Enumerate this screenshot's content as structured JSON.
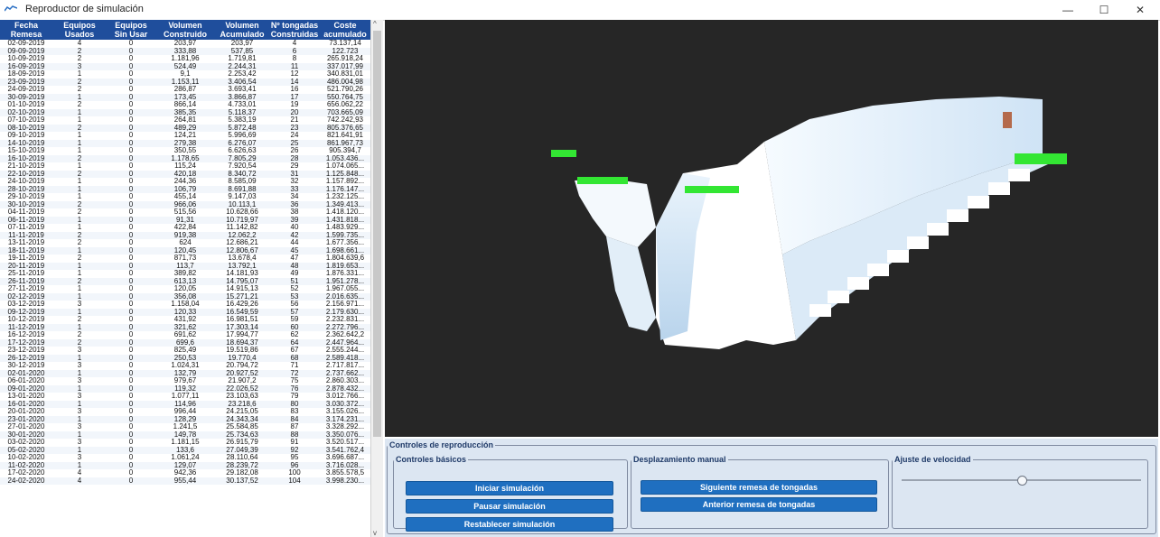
{
  "window": {
    "title": "Reproductor de simulación",
    "controls": {
      "minimize": "—",
      "maximize": "☐",
      "close": "✕"
    }
  },
  "table": {
    "headers": [
      [
        "Fecha",
        "Remesa"
      ],
      [
        "Equipos",
        "Usados"
      ],
      [
        "Equipos",
        "Sin Usar"
      ],
      [
        "Volumen",
        "Construido"
      ],
      [
        "Volumen",
        "Acumulado"
      ],
      [
        "Nº tongadas",
        "Construidas"
      ],
      [
        "Coste",
        "acumulado"
      ]
    ],
    "rows": [
      [
        "02-09-2019",
        "4",
        "0",
        "203,97",
        "203,97",
        "4",
        "73.137,14"
      ],
      [
        "09-09-2019",
        "2",
        "0",
        "333,88",
        "537,85",
        "6",
        "122.723"
      ],
      [
        "10-09-2019",
        "2",
        "0",
        "1.181,96",
        "1.719,81",
        "8",
        "265.918,24"
      ],
      [
        "16-09-2019",
        "3",
        "0",
        "524,49",
        "2.244,31",
        "11",
        "337.017,99"
      ],
      [
        "18-09-2019",
        "1",
        "0",
        "9,1",
        "2.253,42",
        "12",
        "340.831,01"
      ],
      [
        "23-09-2019",
        "2",
        "0",
        "1.153,11",
        "3.406,54",
        "14",
        "486.004,98"
      ],
      [
        "24-09-2019",
        "2",
        "0",
        "286,87",
        "3.693,41",
        "16",
        "521.790,26"
      ],
      [
        "30-09-2019",
        "1",
        "0",
        "173,45",
        "3.866,87",
        "17",
        "550.764,75"
      ],
      [
        "01-10-2019",
        "2",
        "0",
        "866,14",
        "4.733,01",
        "19",
        "656.062,22"
      ],
      [
        "02-10-2019",
        "1",
        "0",
        "385,35",
        "5.118,37",
        "20",
        "703.665,09"
      ],
      [
        "07-10-2019",
        "1",
        "0",
        "264,81",
        "5.383,19",
        "21",
        "742.242,93"
      ],
      [
        "08-10-2019",
        "2",
        "0",
        "489,29",
        "5.872,48",
        "23",
        "805.376,65"
      ],
      [
        "09-10-2019",
        "1",
        "0",
        "124,21",
        "5.996,69",
        "24",
        "821.641,91"
      ],
      [
        "14-10-2019",
        "1",
        "0",
        "279,38",
        "6.276,07",
        "25",
        "861.967,73"
      ],
      [
        "15-10-2019",
        "1",
        "0",
        "350,55",
        "6.626,63",
        "26",
        "905.394,7"
      ],
      [
        "16-10-2019",
        "2",
        "0",
        "1.178,65",
        "7.805,29",
        "28",
        "1.053.436..."
      ],
      [
        "21-10-2019",
        "1",
        "0",
        "115,24",
        "7.920,54",
        "29",
        "1.074.065..."
      ],
      [
        "22-10-2019",
        "2",
        "0",
        "420,18",
        "8.340,72",
        "31",
        "1.125.848..."
      ],
      [
        "24-10-2019",
        "1",
        "0",
        "244,36",
        "8.585,09",
        "32",
        "1.157.892..."
      ],
      [
        "28-10-2019",
        "1",
        "0",
        "106,79",
        "8.691,88",
        "33",
        "1.176.147..."
      ],
      [
        "29-10-2019",
        "1",
        "0",
        "455,14",
        "9.147,03",
        "34",
        "1.232.125..."
      ],
      [
        "30-10-2019",
        "2",
        "0",
        "966,06",
        "10.113,1",
        "36",
        "1.349.413..."
      ],
      [
        "04-11-2019",
        "2",
        "0",
        "515,56",
        "10.628,66",
        "38",
        "1.418.120..."
      ],
      [
        "06-11-2019",
        "1",
        "0",
        "91,31",
        "10.719,97",
        "39",
        "1.431.818..."
      ],
      [
        "07-11-2019",
        "1",
        "0",
        "422,84",
        "11.142,82",
        "40",
        "1.483.929..."
      ],
      [
        "11-11-2019",
        "2",
        "0",
        "919,38",
        "12.062,2",
        "42",
        "1.599.735..."
      ],
      [
        "13-11-2019",
        "2",
        "0",
        "624",
        "12.686,21",
        "44",
        "1.677.356..."
      ],
      [
        "18-11-2019",
        "1",
        "0",
        "120,45",
        "12.806,67",
        "45",
        "1.698.661..."
      ],
      [
        "19-11-2019",
        "2",
        "0",
        "871,73",
        "13.678,4",
        "47",
        "1.804.639,6"
      ],
      [
        "20-11-2019",
        "1",
        "0",
        "113,7",
        "13.792,1",
        "48",
        "1.819.653..."
      ],
      [
        "25-11-2019",
        "1",
        "0",
        "389,82",
        "14.181,93",
        "49",
        "1.876.331..."
      ],
      [
        "26-11-2019",
        "2",
        "0",
        "613,13",
        "14.795,07",
        "51",
        "1.951.278..."
      ],
      [
        "27-11-2019",
        "1",
        "0",
        "120,05",
        "14.915,13",
        "52",
        "1.967.055..."
      ],
      [
        "02-12-2019",
        "1",
        "0",
        "356,08",
        "15.271,21",
        "53",
        "2.016.635..."
      ],
      [
        "03-12-2019",
        "3",
        "0",
        "1.158,04",
        "16.429,26",
        "56",
        "2.156.971..."
      ],
      [
        "09-12-2019",
        "1",
        "0",
        "120,33",
        "16.549,59",
        "57",
        "2.179.630..."
      ],
      [
        "10-12-2019",
        "2",
        "0",
        "431,92",
        "16.981,51",
        "59",
        "2.232.831..."
      ],
      [
        "11-12-2019",
        "1",
        "0",
        "321,62",
        "17.303,14",
        "60",
        "2.272.796..."
      ],
      [
        "16-12-2019",
        "2",
        "0",
        "691,62",
        "17.994,77",
        "62",
        "2.362.642,2"
      ],
      [
        "17-12-2019",
        "2",
        "0",
        "699,6",
        "18.694,37",
        "64",
        "2.447.964..."
      ],
      [
        "23-12-2019",
        "3",
        "0",
        "825,49",
        "19.519,86",
        "67",
        "2.555.244..."
      ],
      [
        "26-12-2019",
        "1",
        "0",
        "250,53",
        "19.770,4",
        "68",
        "2.589.418..."
      ],
      [
        "30-12-2019",
        "3",
        "0",
        "1.024,31",
        "20.794,72",
        "71",
        "2.717.817..."
      ],
      [
        "02-01-2020",
        "1",
        "0",
        "132,79",
        "20.927,52",
        "72",
        "2.737.662..."
      ],
      [
        "06-01-2020",
        "3",
        "0",
        "979,67",
        "21.907,2",
        "75",
        "2.860.303..."
      ],
      [
        "09-01-2020",
        "1",
        "0",
        "119,32",
        "22.026,52",
        "76",
        "2.878.432..."
      ],
      [
        "13-01-2020",
        "3",
        "0",
        "1.077,11",
        "23.103,63",
        "79",
        "3.012.766..."
      ],
      [
        "16-01-2020",
        "1",
        "0",
        "114,96",
        "23.218,6",
        "80",
        "3.030.372..."
      ],
      [
        "20-01-2020",
        "3",
        "0",
        "996,44",
        "24.215,05",
        "83",
        "3.155.026..."
      ],
      [
        "23-01-2020",
        "1",
        "0",
        "128,29",
        "24.343,34",
        "84",
        "3.174.231..."
      ],
      [
        "27-01-2020",
        "3",
        "0",
        "1.241,5",
        "25.584,85",
        "87",
        "3.328.292..."
      ],
      [
        "30-01-2020",
        "1",
        "0",
        "149,78",
        "25.734,63",
        "88",
        "3.350.076..."
      ],
      [
        "03-02-2020",
        "3",
        "0",
        "1.181,15",
        "26.915,79",
        "91",
        "3.520.517..."
      ],
      [
        "05-02-2020",
        "1",
        "0",
        "133,6",
        "27.049,39",
        "92",
        "3.541.762,4"
      ],
      [
        "10-02-2020",
        "3",
        "0",
        "1.061,24",
        "28.110,64",
        "95",
        "3.696.687..."
      ],
      [
        "11-02-2020",
        "1",
        "0",
        "129,07",
        "28.239,72",
        "96",
        "3.716.028..."
      ],
      [
        "17-02-2020",
        "4",
        "0",
        "942,36",
        "29.182,08",
        "100",
        "3.855.578,5"
      ],
      [
        "24-02-2020",
        "4",
        "0",
        "955,44",
        "30.137,52",
        "104",
        "3.998.230..."
      ]
    ],
    "scroll": {
      "up": "^",
      "down": "v",
      "position_fraction": 0.0
    }
  },
  "controls": {
    "title": "Controles de reproducción",
    "basic": {
      "title": "Controles básicos",
      "start": "Iniciar simulación",
      "pause": "Pausar simulación",
      "reset": "Restablecer simulación"
    },
    "manual": {
      "title": "Desplazamiento manual",
      "next": "Siguiente remesa de tongadas",
      "prev": "Anterior remesa de tongadas"
    },
    "speed": {
      "title": "Ajuste de velocidad",
      "value_fraction": 0.5
    }
  },
  "colors": {
    "header_bg": "#1f4e9c",
    "button_bg": "#1f6fc0",
    "viewport_bg": "#262626",
    "green": "#33e633",
    "ice": "#e4f1fb"
  }
}
